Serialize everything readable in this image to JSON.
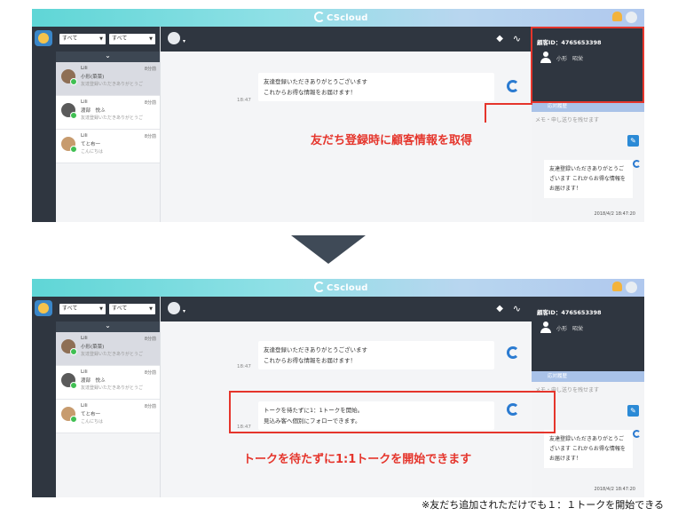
{
  "app": {
    "logo_text": "CScloud"
  },
  "filters": {
    "left": "すべて",
    "right": "すべて"
  },
  "conversations": [
    {
      "name": "Lili",
      "nick": "小形(菜菜)",
      "msg": "友達登録いただきありがとうご",
      "time": "8分前"
    },
    {
      "name": "Lili",
      "nick": "渡部　悦ふ",
      "msg": "友達登録いただきありがとうご",
      "time": "8分前"
    },
    {
      "name": "Lili",
      "nick": "てと布一",
      "msg": "こんにちは",
      "time": "8分前"
    }
  ],
  "customer": {
    "id_label": "顧客ID：4765653398",
    "name": "小形　昭栄"
  },
  "history_tab": "応対履歴",
  "memo_placeholder": "メモ・申し送りを残せます",
  "messages": {
    "welcome_line1": "友達登録いただきありがとうございます",
    "welcome_line2": "これからお得な情報をお届けます！",
    "welcome_time": "18:47",
    "start_line1": "トークを待たずに1：1トークを開始。",
    "start_line2": "見込み客へ個別にフォローできます。",
    "start_time": "18:47"
  },
  "right_bubble": "友達登録いただきありがとうございます これからお得な情報をお届けます！",
  "right_date": "2018/4/2 18:47:20",
  "annotations": {
    "top": "友だち登録時に顧客情報を取得",
    "bottom": "トークを待たずに1:1トークを開始できます",
    "footnote": "※友だち追加されただけでも１：１トークを開始できる"
  },
  "colors": {
    "accent_red": "#e5352c",
    "dark_nav": "#2f3640",
    "brand_blue": "#2b7bd1"
  }
}
